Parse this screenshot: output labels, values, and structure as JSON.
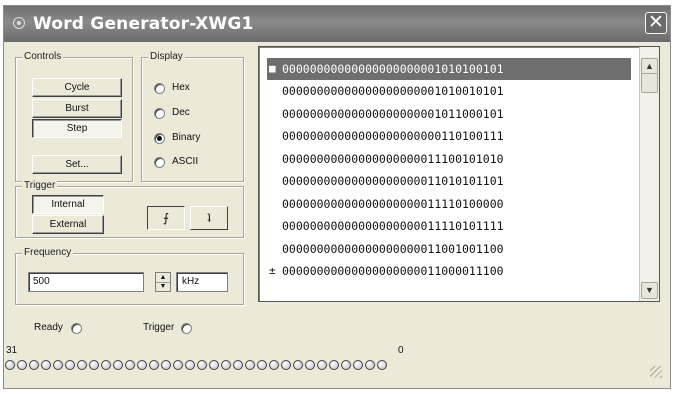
{
  "window": {
    "title": "Word Generator-XWG1",
    "close_label": "✕"
  },
  "controls": {
    "group_label": "Controls",
    "cycle_label": "Cycle",
    "burst_label": "Burst",
    "step_label": "Step",
    "set_label": "Set..."
  },
  "display": {
    "group_label": "Display",
    "options": [
      "Hex",
      "Dec",
      "Binary",
      "ASCII"
    ],
    "selected": "Binary"
  },
  "trigger": {
    "group_label": "Trigger",
    "internal_label": "Internal",
    "external_label": "External",
    "rising_edge_symbol": "⨍",
    "falling_edge_symbol": "ʇ"
  },
  "frequency": {
    "group_label": "Frequency",
    "value": "500",
    "unit": "kHz"
  },
  "words": [
    "00000000000000000000001010100101",
    "00000000000000000000001010010101",
    "00000000000000000000001011000101",
    "00000000000000000000000110100111",
    "00000000000000000000011100101010",
    "00000000000000000000011010101101",
    "00000000000000000000011110100000",
    "00000000000000000000011110101111",
    "00000000000000000000011001001100",
    "00000000000000000000011000011100"
  ],
  "status": {
    "ready_label": "Ready",
    "trigger_label": "Trigger"
  },
  "bits": {
    "msb_label": "31",
    "lsb_label": "0",
    "led_count": 32
  }
}
